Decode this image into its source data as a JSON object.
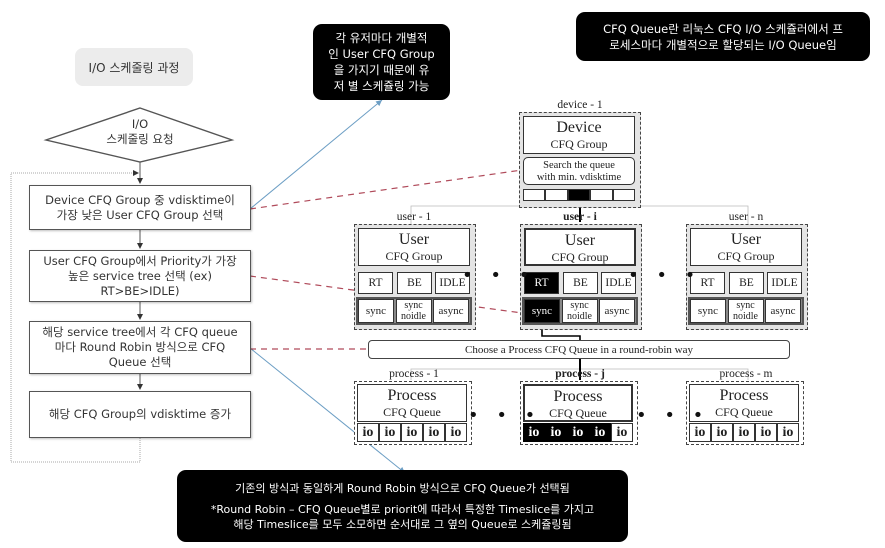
{
  "flowchart": {
    "title": "I/O 스케줄링 과정",
    "start": [
      "I/O",
      "스케줄링 요청"
    ],
    "steps": [
      {
        "lines": [
          "Device CFQ Group 중 vdisktime이",
          "가장 낮은 User CFQ Group 선택"
        ]
      },
      {
        "lines": [
          "User CFQ Group에서 Priority가 가장",
          "높은 service tree 선택 (ex)",
          "RT>BE>IDLE)"
        ]
      },
      {
        "lines": [
          "해당 service tree에서 각 CFQ queue",
          "마다 Round Robin 방식으로 CFQ",
          "Queue 선택"
        ]
      },
      {
        "lines": [
          "해당 CFQ Group의 vdisktime 증가"
        ]
      }
    ]
  },
  "callouts": {
    "user_group": [
      "각 유저마다 개별적",
      "인 User CFQ Group",
      "을 가지기 때문에 유",
      "저 별 스케쥴링 가능"
    ],
    "definition": [
      "CFQ Queue란 리눅스 CFQ I/O 스케쥴러에서 프",
      "로세스마다 개별적으로 할당되는 I/O Queue임"
    ],
    "round_robin": [
      "기존의 방식과 동일하게 Round Robin 방식으로 CFQ Queue가 선택됨",
      "",
      "*Round Robin – CFQ Queue별로 priorit에 따라서 특정한 Timeslice를 가지고",
      "해당  Timeslice를 모두 소모하면 순서대로 그 옆의 Queue로 스케쥴링됨"
    ]
  },
  "device": {
    "label": "device - 1",
    "title": "Device",
    "subtitle": "CFQ Group",
    "search": [
      "Search the queue",
      "with min. vdisktime"
    ],
    "slots": 5,
    "selected_slot": 2
  },
  "users": [
    {
      "label": "user - 1",
      "title": "User",
      "subtitle": "CFQ Group",
      "selected": false,
      "classes": [
        "RT",
        "BE",
        "IDLE"
      ],
      "trees": [
        "sync",
        "sync noidle",
        "async"
      ]
    },
    {
      "label": "user - i",
      "title": "User",
      "subtitle": "CFQ Group",
      "selected": true,
      "classes": [
        "RT",
        "BE",
        "IDLE"
      ],
      "trees": [
        "sync",
        "sync noidle",
        "async"
      ]
    },
    {
      "label": "user - n",
      "title": "User",
      "subtitle": "CFQ Group",
      "selected": false,
      "classes": [
        "RT",
        "BE",
        "IDLE"
      ],
      "trees": [
        "sync",
        "sync noidle",
        "async"
      ]
    }
  ],
  "round_robin_bar": "Choose a Process CFQ Queue in a round-robin way",
  "processes": [
    {
      "label": "process - 1",
      "title": "Process",
      "subtitle": "CFQ Queue",
      "selected": false,
      "ios": [
        "io",
        "io",
        "io",
        "io",
        "io"
      ],
      "consumed": 0
    },
    {
      "label": "process - j",
      "title": "Process",
      "subtitle": "CFQ Queue",
      "selected": true,
      "ios": [
        "io",
        "io",
        "io",
        "io",
        "io"
      ],
      "consumed": 4
    },
    {
      "label": "process - m",
      "title": "Process",
      "subtitle": "CFQ Queue",
      "selected": false,
      "ios": [
        "io",
        "io",
        "io",
        "io",
        "io"
      ],
      "consumed": 0
    }
  ],
  "ellipsis": "• • •",
  "colors": {
    "connector_blue": "#6c9ec4",
    "connector_red": "#b04a5a",
    "highlight": "#000000"
  }
}
